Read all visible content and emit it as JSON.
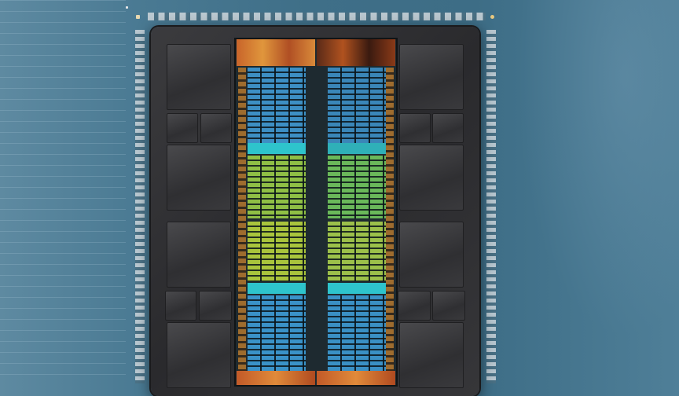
{
  "scene": {
    "subject": "",
    "accent_colors": {
      "background": "#4a7a93",
      "package": "#2f2f32",
      "cores_blue": "#3aa0d8",
      "cores_green": "#9ccc3a",
      "cores_cyan": "#2ec4cc",
      "die_edge_orange": "#d98a3a",
      "pads": "#cfd7dc"
    }
  }
}
